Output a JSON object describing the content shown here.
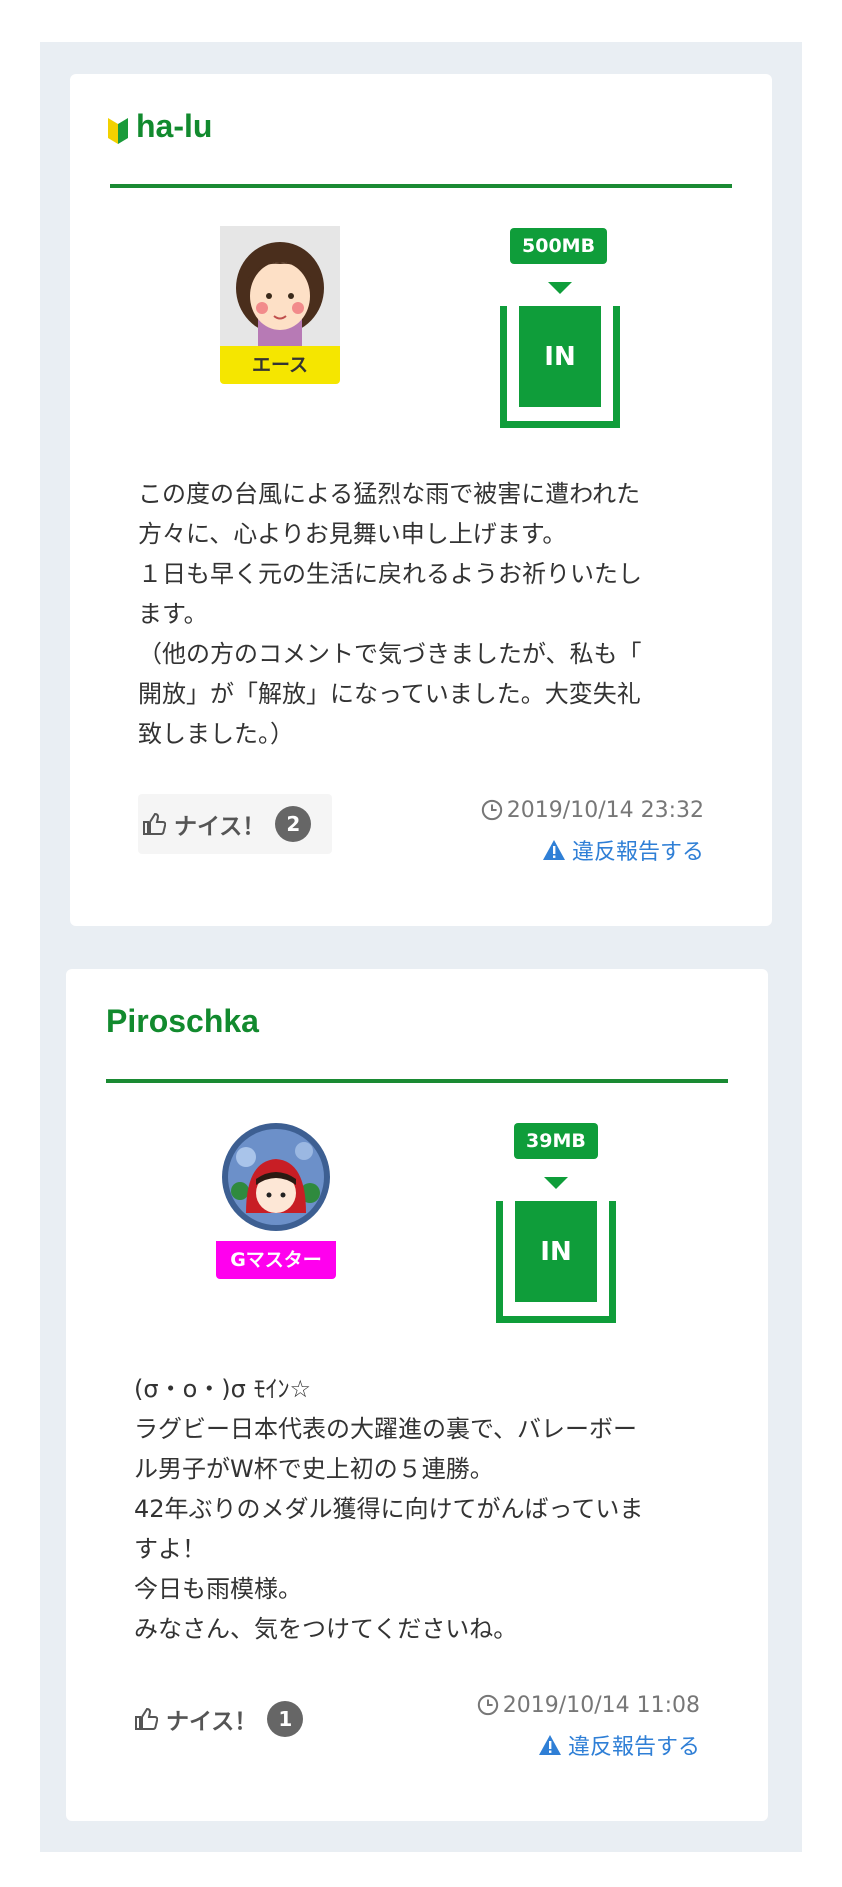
{
  "comments": [
    {
      "username": "ha-lu",
      "beginner_mark": true,
      "avatar": "woman-avatar",
      "rank": "エース",
      "rank_color": "#f5e600",
      "data_amount": "500MB",
      "status": "IN",
      "text": "この度の台風による猛烈な雨で被害に遭われた\n方々に、心よりお見舞い申し上げます。\n１日も早く元の生活に戻れるようお祈りいたし\nます。\n（他の方のコメントで気づきましたが、私も「\n開放」が「解放」になっていました。大変失礼\n致しました。）",
      "nice_label": "ナイス！",
      "nice_count": "2",
      "timestamp": "2019/10/14 23:32",
      "report_label": "違反報告する"
    },
    {
      "username": "Piroschka",
      "beginner_mark": false,
      "avatar": "red-hood-avatar",
      "rank": "Gマスター",
      "rank_color": "#ff00ee",
      "data_amount": "39MB",
      "status": "IN",
      "text": "(σ・o・)σ ﾓｲﾝ☆\nラグビー日本代表の大躍進の裏で、バレーボー\nル男子がW杯で史上初の５連勝。\n42年ぶりのメダル獲得に向けてがんばっていま\nすよ！\n今日も雨模様。\nみなさん、気をつけてくださいね。",
      "nice_label": "ナイス！",
      "nice_count": "1",
      "timestamp": "2019/10/14 11:08",
      "report_label": "違反報告する"
    }
  ]
}
